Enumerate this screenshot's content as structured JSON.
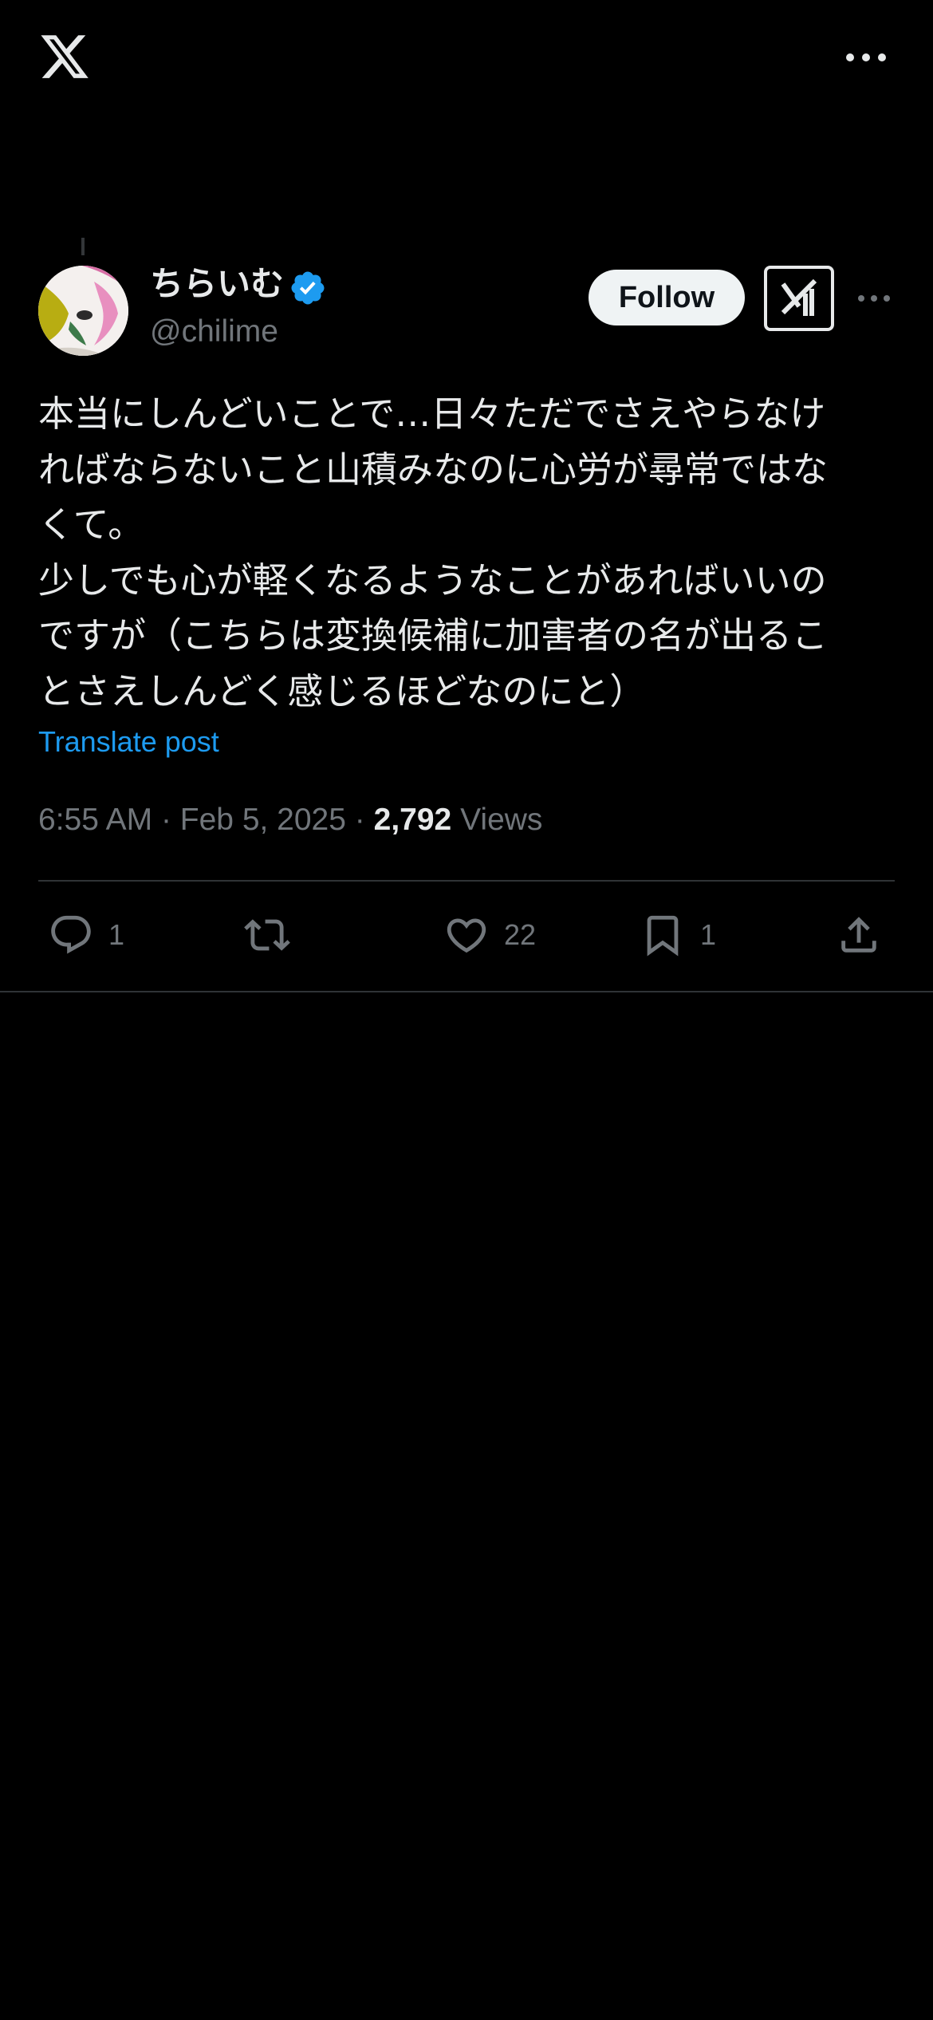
{
  "header": {
    "logo_icon": "x-logo-icon",
    "more_icon": "more-horizontal-icon"
  },
  "post": {
    "author": {
      "display_name": "ちらいむ",
      "handle": "@chilime",
      "verified": true,
      "verified_color": "#1d9bf0"
    },
    "follow_label": "Follow",
    "grok_icon": "grok-icon",
    "text": "本当にしんどいことで…日々ただでさえやらなけ\nればならないこと山積みなのに心労が尋常ではな\nくて。\n少しでも心が軽くなるようなことがあればいいの\nですが（こちらは変換候補に加害者の名が出るこ\nとさえしんどく感じるほどなのにと）",
    "translate_label": "Translate post",
    "time": "6:55 AM",
    "date": "Feb 5, 2025",
    "separator": "·",
    "views_count": "2,792",
    "views_label": "Views"
  },
  "actions": {
    "reply_count": "1",
    "repost_count": "",
    "like_count": "22",
    "bookmark_count": "1"
  },
  "colors": {
    "background": "#000000",
    "text": "#e7e9ea",
    "secondary": "#71767b",
    "accent": "#1d9bf0"
  }
}
